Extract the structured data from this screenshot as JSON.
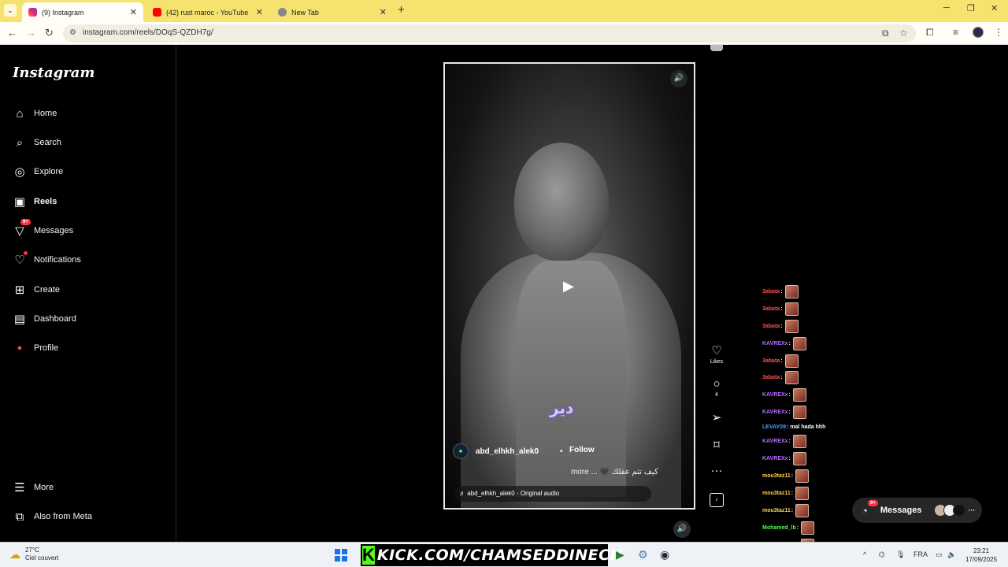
{
  "browser": {
    "tabs": [
      {
        "title": "(9) Instagram",
        "active": true,
        "icon": "instagram-icon"
      },
      {
        "title": "(42) rust maroc - YouTube",
        "active": false,
        "icon": "youtube-icon"
      },
      {
        "title": "New Tab",
        "active": false,
        "icon": "chrome-icon"
      }
    ],
    "url": "instagram.com/reels/DOqS-QZDH7g/"
  },
  "sidebar": {
    "logo": "Instagram",
    "items": [
      {
        "label": "Home",
        "icon": "home-icon"
      },
      {
        "label": "Search",
        "icon": "search-icon"
      },
      {
        "label": "Explore",
        "icon": "compass-icon"
      },
      {
        "label": "Reels",
        "icon": "reels-icon"
      },
      {
        "label": "Messages",
        "icon": "messenger-icon",
        "badge": "9+"
      },
      {
        "label": "Notifications",
        "icon": "heart-icon"
      },
      {
        "label": "Create",
        "icon": "plus-square-icon"
      },
      {
        "label": "Dashboard",
        "icon": "chart-icon"
      },
      {
        "label": "Profile",
        "icon": "avatar-icon"
      }
    ],
    "bottom": [
      {
        "label": "More",
        "icon": "hamburger-icon"
      },
      {
        "label": "Also from Meta",
        "icon": "meta-grid-icon"
      }
    ]
  },
  "reel": {
    "overlay_text": "دير",
    "author": "abd_elhkh_alek0",
    "follow": "Follow",
    "caption": "كيف تتم عقلك 🖤 ... more",
    "audio": "♬ abd_elhkh_alek0 · Original audio",
    "actions": {
      "likes_label": "Likes",
      "comments_count": "4"
    }
  },
  "chat": [
    {
      "user": "3abata",
      "color": "#ff4d4d"
    },
    {
      "user": "3abata",
      "color": "#ff4d4d"
    },
    {
      "user": "3abata",
      "color": "#ff4d4d"
    },
    {
      "user": "KAVREXx",
      "color": "#b36bff"
    },
    {
      "user": "3abata",
      "color": "#ff4d4d"
    },
    {
      "user": "3abata",
      "color": "#ff4d4d"
    },
    {
      "user": "KAVREXx",
      "color": "#b36bff"
    },
    {
      "user": "KAVREXx",
      "color": "#b36bff"
    },
    {
      "user": "LEVAY09",
      "color": "#4d9bff",
      "text": "mal hada hhh"
    },
    {
      "user": "KAVREXx",
      "color": "#b36bff"
    },
    {
      "user": "KAVREXx",
      "color": "#b36bff"
    },
    {
      "user": "mou3taz11",
      "color": "#ffd24d"
    },
    {
      "user": "mou3taz11",
      "color": "#ffd24d"
    },
    {
      "user": "mou3taz11",
      "color": "#ffd24d"
    },
    {
      "user": "Mohamed_lb",
      "color": "#4dff4d"
    },
    {
      "user": "Mohamed_lb",
      "color": "#4dff4d"
    }
  ],
  "messages_pill": {
    "label": "Messages",
    "badge": "9+"
  },
  "taskbar": {
    "weather_temp": "27°C",
    "weather_desc": "Ciel couvert",
    "kick_text": "KICK.COM/CHAMSEDDINECH",
    "lang": "FRA",
    "time": "23:21",
    "date": "17/09/2025"
  }
}
